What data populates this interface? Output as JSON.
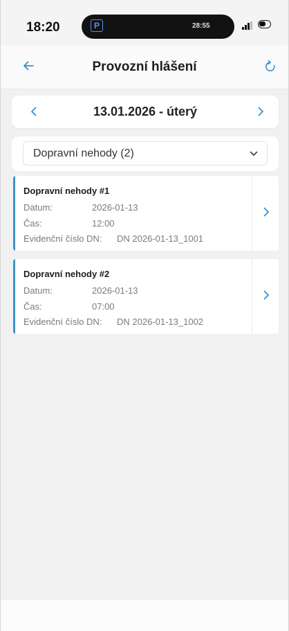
{
  "status_bar": {
    "time": "18:20",
    "live_activity_icon": "parking-icon",
    "live_activity_letter": "P",
    "live_activity_timer": "28:55",
    "signal_icon": "cellular-signal-icon",
    "battery_icon": "battery-icon"
  },
  "header": {
    "title": "Provozní hlášení",
    "back_icon": "arrow-left-icon",
    "refresh_icon": "refresh-icon"
  },
  "date_nav": {
    "date": "13.01.2026 - úterý",
    "prev_icon": "chevron-left-icon",
    "next_icon": "chevron-right-icon"
  },
  "category_select": {
    "selected": "Dopravní nehody (2)",
    "icon": "chevron-down-icon"
  },
  "records": [
    {
      "title": "Dopravní nehody #1",
      "date_label": "Datum:",
      "date_value": "2026-01-13",
      "time_label": "Čas:",
      "time_value": "12:00",
      "ref_label": "Evidenční číslo DN:",
      "ref_value": "DN 2026-01-13_1001"
    },
    {
      "title": "Dopravní nehody #2",
      "date_label": "Datum:",
      "date_value": "2026-01-13",
      "time_label": "Čas:",
      "time_value": "07:00",
      "ref_label": "Evidenční číslo DN:",
      "ref_value": "DN 2026-01-13_1002"
    }
  ],
  "colors": {
    "accent": "#3b93c6",
    "icon_blue": "#3a8fc9",
    "background": "#f1f1f1"
  }
}
